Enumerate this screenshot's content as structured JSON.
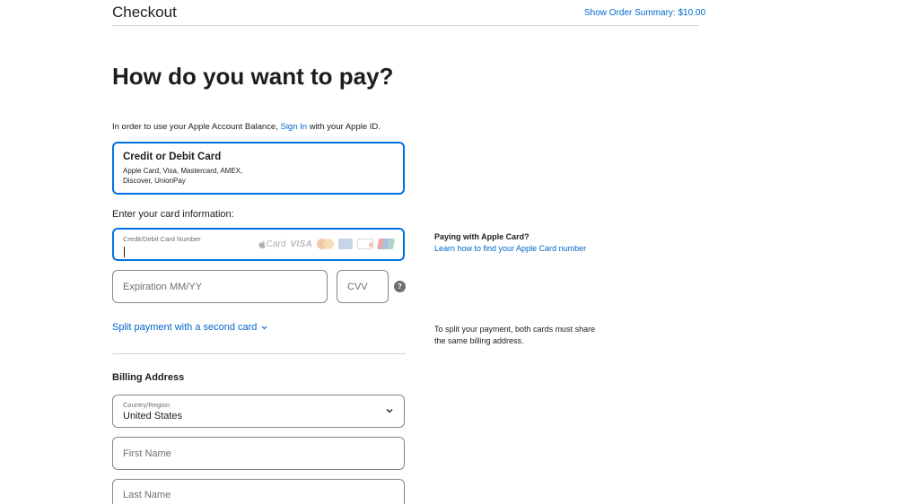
{
  "header": {
    "title": "Checkout",
    "order_summary": "Show Order Summary: $10.00"
  },
  "main": {
    "heading": "How do you want to pay?",
    "signin": {
      "before": "In order to use your Apple Account Balance, ",
      "link": "Sign In",
      "after": " with your Apple ID."
    },
    "payment_option": {
      "title": "Credit or Debit Card",
      "subtitle": "Apple Card, Visa, Mastercard, AMEX, Discover, UnionPay"
    },
    "card_info_label": "Enter your card information:",
    "card_number": {
      "label": "Credit/Debit Card Number",
      "value": ""
    },
    "card_logos": {
      "apple_card": "Card",
      "visa": "VISA"
    },
    "expiration": {
      "placeholder": "Expiration MM/YY"
    },
    "cvv": {
      "placeholder": "CVV"
    },
    "help_icon": "?",
    "split_payment": "Split payment with a second card",
    "billing": {
      "heading": "Billing Address",
      "country": {
        "label": "Country/Region",
        "value": "United States"
      },
      "first_name": {
        "placeholder": "First Name"
      },
      "last_name": {
        "placeholder": "Last Name"
      }
    }
  },
  "sidebar": {
    "apple_card_heading": "Paying with Apple Card?",
    "apple_card_link": "Learn how to find your Apple Card number",
    "split_note": "To split your payment, both cards must share the same billing address."
  },
  "colors": {
    "accent": "#0071e3",
    "link": "#0066cc",
    "text": "#1d1d1f",
    "muted": "#6e6e73"
  },
  "icons": {
    "chevron": "chevron-down-icon",
    "help": "question-mark-icon",
    "apple": "apple-logo-icon"
  }
}
